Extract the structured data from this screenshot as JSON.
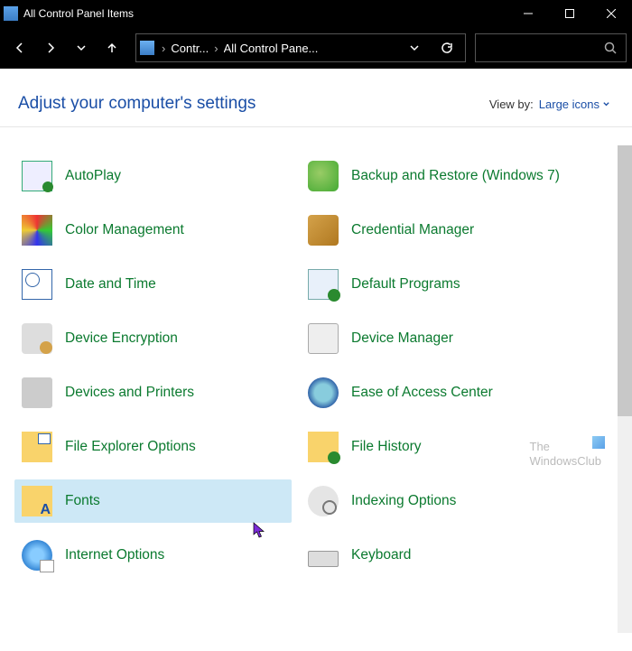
{
  "window": {
    "title": "All Control Panel Items"
  },
  "address": {
    "seg1": "Contr...",
    "seg2": "All Control Pane..."
  },
  "heading": "Adjust your computer's settings",
  "viewby": {
    "label": "View by:",
    "value": "Large icons"
  },
  "items": {
    "left": [
      {
        "label": "AutoPlay",
        "icon": "autoplay"
      },
      {
        "label": "Color Management",
        "icon": "color"
      },
      {
        "label": "Date and Time",
        "icon": "date"
      },
      {
        "label": "Device Encryption",
        "icon": "devenc"
      },
      {
        "label": "Devices and Printers",
        "icon": "devprint"
      },
      {
        "label": "File Explorer Options",
        "icon": "fileexp"
      },
      {
        "label": "Fonts",
        "icon": "fonts"
      },
      {
        "label": "Internet Options",
        "icon": "inet"
      }
    ],
    "right": [
      {
        "label": "Backup and Restore (Windows 7)",
        "icon": "backup"
      },
      {
        "label": "Credential Manager",
        "icon": "cred"
      },
      {
        "label": "Default Programs",
        "icon": "defprog"
      },
      {
        "label": "Device Manager",
        "icon": "devmgr"
      },
      {
        "label": "Ease of Access Center",
        "icon": "ease"
      },
      {
        "label": "File History",
        "icon": "filehist"
      },
      {
        "label": "Indexing Options",
        "icon": "index"
      },
      {
        "label": "Keyboard",
        "icon": "keyb"
      }
    ]
  },
  "selected_index_left": 6,
  "watermark": {
    "line1": "The",
    "line2": "WindowsClub"
  }
}
